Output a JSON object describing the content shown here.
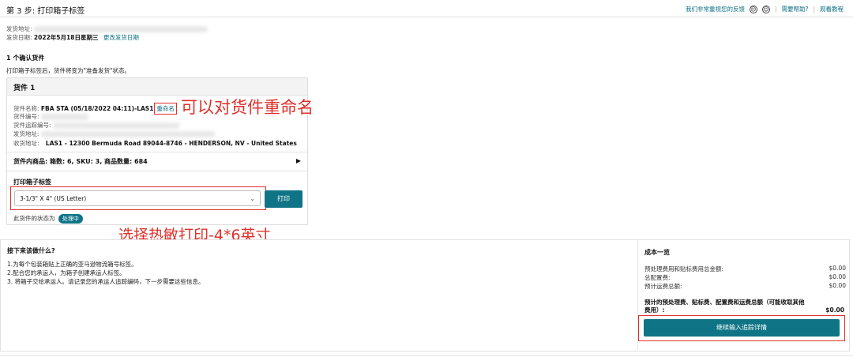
{
  "header": {
    "step": "第 3 步:  打印箱子标签",
    "feedback_link": "我们非常重视您的反馈",
    "help_link": "需要帮助?",
    "tutorial_link": "观看教程"
  },
  "shipping": {
    "address_label": "发货地址:",
    "date_label": "发货日期:",
    "date_value": "2022年5月18日星期三",
    "change_date_link": "更改发货日期"
  },
  "confirm": {
    "title": "1 个确认货件",
    "description": "打印箱子标签后，货件将变为\"准备发货\"状态。"
  },
  "shipment_card": {
    "title": "货件 1",
    "name_label": "货件名称:",
    "name_value": "FBA STA (05/18/2022 04:11)-LAS1",
    "rename_link": "重命名",
    "id_label": "货件编号:",
    "tracking_label": "货件追踪编号:",
    "from_label": "发货地址:",
    "to_label": "收货地址:",
    "to_value": "LAS1 - 12300 Bermuda Road 89044-8746 - HENDERSON, NV - United States",
    "contents": "货件内商品: 箱数: 6, SKU: 3, 商品数量: 684",
    "expand_icon": "caret-right",
    "print_label_title": "打印箱子标签",
    "label_size_selected": "3-1/3\" X 4\" (US Letter)",
    "print_button": "打印",
    "status_label": "此货件的状态为",
    "status_badge": "处理中"
  },
  "annotations": {
    "rename_note": "可以对货件重命名",
    "thermal_note": "选择热敏打印-4*6英寸"
  },
  "next_steps": {
    "title": "接下来该做什么?",
    "items": [
      "1.为每个包装箱贴上正确的亚马逊物流箱号标签。",
      "2.配合您的承运人，为箱子创建承运人标签。",
      "3. 将箱子交给承运人。请记录您的承运人追踪编码，下一步需要这些信息。"
    ]
  },
  "cost_summary": {
    "title": "成本一览",
    "rows": [
      {
        "label": "预处理费用和贴标费用总金额:",
        "value": "$0.00"
      },
      {
        "label": "总配置费:",
        "value": "$0.00"
      },
      {
        "label": "预计运费总额:",
        "value": "$0.00"
      }
    ],
    "total_label": "预计的预处理费、贴标费、配置费和运费总额（可能收取其他费用）:",
    "total_value": "$0.00",
    "continue_button": "继续输入追踪详情"
  },
  "colors": {
    "accent": "#0f7486",
    "annotation": "#e0302a",
    "link": "#0a6e86"
  }
}
